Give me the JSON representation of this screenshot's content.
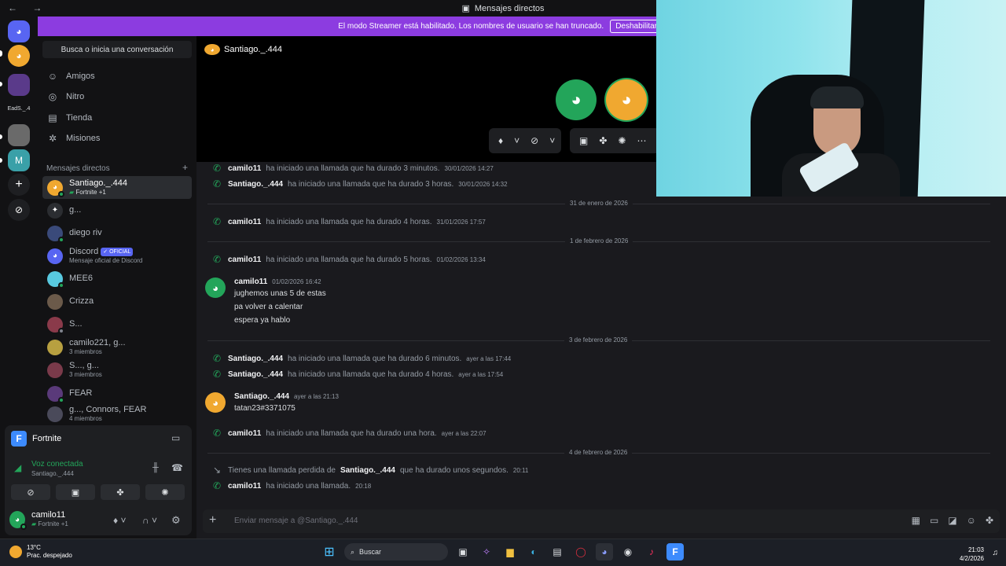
{
  "window": {
    "title": "Mensajes directos",
    "nav": "← →"
  },
  "banner": {
    "text": "El modo Streamer está habilitado. Los nombres de usuario se han truncado.",
    "button": "Deshabilitar"
  },
  "rail": {
    "label": "EadS._.4"
  },
  "sidebar": {
    "search_placeholder": "Busca o inicia una conversación",
    "nav": [
      {
        "label": "Amigos",
        "icon": "friends-icon"
      },
      {
        "label": "Nitro",
        "icon": "nitro-icon"
      },
      {
        "label": "Tienda",
        "icon": "shop-icon"
      },
      {
        "label": "Misiones",
        "icon": "quests-icon"
      }
    ],
    "dm_header": "Mensajes directos",
    "dm_add": "+",
    "dms": [
      {
        "name": "Santiago._.444",
        "sub": "Fortnite +1",
        "color": "#f0a830"
      },
      {
        "name": "g...",
        "sub": "",
        "color": "#2b2d31"
      },
      {
        "name": "diego riv",
        "sub": "",
        "color": "#3a4a7a"
      },
      {
        "name": "Discord",
        "badge": "✓ OFICIAL",
        "sub": "Mensaje oficial de Discord",
        "color": "#5865f2"
      },
      {
        "name": "MEE6",
        "sub": "",
        "color": "#58c9e0"
      },
      {
        "name": "Crizza",
        "sub": "",
        "color": "#6b5a4a"
      },
      {
        "name": "S...",
        "sub": "",
        "color": "#8a3a4a"
      },
      {
        "name": "camilo221, g...",
        "sub": "3 miembros",
        "color": "#b8a040"
      },
      {
        "name": "S..., g...",
        "sub": "3 miembros",
        "color": "#7a3a4a"
      },
      {
        "name": "FEAR",
        "sub": "",
        "color": "#5a3a7a"
      },
      {
        "name": "g..., Connors, FEAR",
        "sub": "4 miembros",
        "color": "#4a4a5a"
      }
    ]
  },
  "voice": {
    "game": "Fortnite",
    "status": "Voz conectada",
    "channel": "Santiago._.444"
  },
  "user": {
    "name": "camilo11",
    "activity": "Fortnite +1"
  },
  "call": {
    "name": "Santiago._.444"
  },
  "messages": {
    "rows": [
      {
        "author": "camilo11",
        "text": "ha iniciado una llamada que ha durado 3 minutos.",
        "time": "30/01/2026 14:27"
      },
      {
        "author": "Santiago._.444",
        "text": "ha iniciado una llamada que ha durado 3 horas.",
        "time": "30/01/2026 14:32"
      },
      {
        "author": "camilo11",
        "text": "ha iniciado una llamada que ha durado 4 horas.",
        "time": "31/01/2026 17:57"
      },
      {
        "author": "camilo11",
        "text": "ha iniciado una llamada que ha durado 5 horas.",
        "time": "01/02/2026 13:34"
      },
      {
        "author": "Santiago._.444",
        "text": "ha iniciado una llamada que ha durado 6 minutos.",
        "time": "ayer a las 17:44"
      },
      {
        "author": "Santiago._.444",
        "text": "ha iniciado una llamada que ha durado 4 horas.",
        "time": "ayer a las 17:54"
      },
      {
        "author": "camilo11",
        "text": "ha iniciado una llamada que ha durado una hora.",
        "time": "ayer a las 22:07"
      },
      {
        "author": "camilo11",
        "text": "ha iniciado una llamada.",
        "time": "20:18"
      }
    ],
    "missed": {
      "pre": "Tienes una llamada perdida de",
      "author": "Santiago._.444",
      "post": "que ha durado unos segundos.",
      "time": "20:11"
    },
    "dividers": [
      "31 de enero de 2026",
      "1 de febrero de 2026",
      "3 de febrero de 2026",
      "4 de febrero de 2026"
    ],
    "group1": {
      "author": "camilo11",
      "time": "01/02/2026 16:42",
      "lines": [
        "jughemos unas 5 de estas",
        "pa volver a calentar",
        "espera ya hablo"
      ]
    },
    "group2": {
      "author": "Santiago._.444",
      "time": "ayer a las 21:13",
      "lines": [
        "tatan23#3371075"
      ]
    }
  },
  "composer": {
    "placeholder": "Enviar mensaje a @Santiago._.444"
  },
  "taskbar": {
    "temp": "13°C",
    "weather": "Prac. despejado",
    "search": "Buscar",
    "time": "21:03",
    "date": "4/2/2026"
  },
  "colors": {
    "accent": "#5865f2",
    "green": "#23a55a",
    "banner": "#8c3ce0",
    "orange": "#f0a830"
  }
}
